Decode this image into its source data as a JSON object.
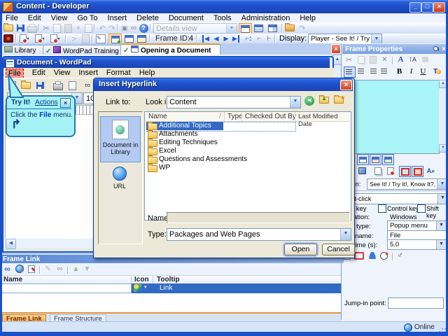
{
  "window": {
    "title": "Content - Developer"
  },
  "menu": {
    "items": [
      "File",
      "Edit",
      "View",
      "Go To",
      "Insert",
      "Delete",
      "Document",
      "Tools",
      "Administration",
      "Help"
    ]
  },
  "toolbar": {
    "details_view": "Details view",
    "frame_id_label": "Frame ID:",
    "frame_id_value": "4",
    "display_label": "Display:",
    "display_value": "Player - See It! / Try It!"
  },
  "tabs": {
    "library": "Library",
    "training": "WordPad Training",
    "active": "Opening a Document"
  },
  "wordpad": {
    "title": "Document - WordPad",
    "menu": [
      "File",
      "Edit",
      "View",
      "Insert",
      "Format",
      "Help"
    ],
    "font_size": "10"
  },
  "tryit": {
    "title": "Try It!",
    "actions_link": "Actions",
    "instruction_prefix": "Click the ",
    "instruction_bold": "File",
    "instruction_suffix": " menu."
  },
  "dialog": {
    "title": "Insert Hyperlink",
    "link_to_label": "Link to:",
    "look_in_label": "Look in:",
    "look_in_value": "Content",
    "sidebar_item_1": "Document in Library",
    "sidebar_item_2": "URL",
    "columns": [
      "Name",
      "Type",
      "Checked Out By",
      "Last Modified Date"
    ],
    "folders": [
      "Additional Topics",
      "Attachments",
      "Editing Techniques",
      "Excel",
      "Questions and Assessments",
      "WP"
    ],
    "name_label": "Name:",
    "name_value": "",
    "type_label": "Type:",
    "type_value": "Packages and Web Pages",
    "open_button": "Open",
    "cancel_button": "Cancel"
  },
  "frame_properties": {
    "title": "Frame Properties",
    "show_in_label": "Show in:",
    "show_in_value": "See It! / Try It!, Know It?, Do It!",
    "action_value": "Left-click",
    "alt_key_label": "Alt key",
    "control_key_label": "Control key",
    "shift_key_label": "Shift key",
    "application_label": "Application:",
    "application_value": "Windows Application",
    "object_type_label": "Object type:",
    "object_type_value": "Popup menu",
    "object_name_label": "Object name:",
    "object_name_value": "File",
    "delay_label": "Delay time (s):",
    "delay_value": "5.0",
    "jump_in_label": "Jump-in point:",
    "jump_in_value": ""
  },
  "frame_link": {
    "title": "Frame Link",
    "columns": [
      "Name",
      "Icon",
      "Tooltip"
    ],
    "row": {
      "name": "",
      "tooltip": "Link"
    },
    "tabs": [
      "Frame Link",
      "Frame Structure"
    ]
  },
  "status": {
    "online": "Online"
  },
  "icons": {
    "cut": "✂",
    "pencil": "✎",
    "link": "∞",
    "male": "♂",
    "undo": "↶",
    "redo": "↷",
    "check": "✓",
    "close": "×",
    "up": "▲",
    "down": "▼",
    "left": "◀",
    "right": "▶",
    "small_down": "▾",
    "tryit_arrow": "↱",
    "asterisk": "∗",
    "help": "?"
  }
}
